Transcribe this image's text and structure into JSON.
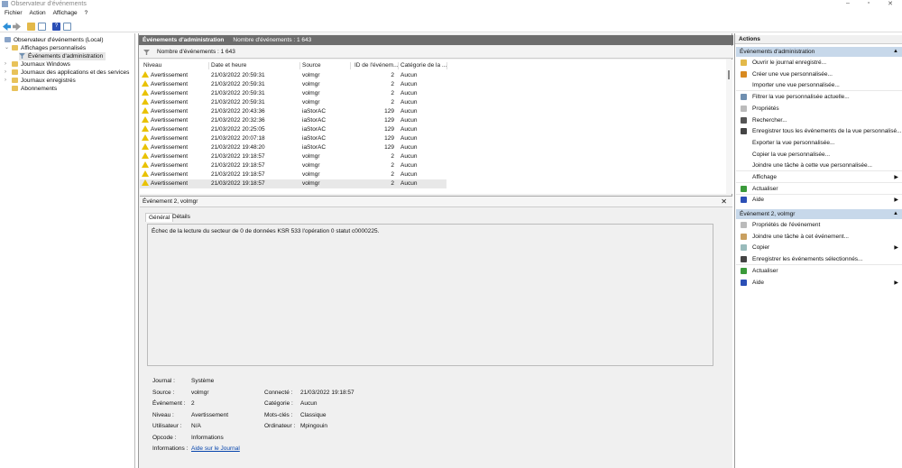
{
  "window": {
    "title": "Observateur d'événements"
  },
  "menu": [
    "Fichier",
    "Action",
    "Affichage",
    "?"
  ],
  "toolbar": [
    "back-icon",
    "forward-icon",
    "folder-up-icon",
    "console-tree-icon",
    "help-icon",
    "action-pane-icon"
  ],
  "tree": {
    "root": "Observateur d'événements (Local)",
    "custom_views": "Affichages personnalisés",
    "admin_events": "Événements d'administration",
    "windows_logs": "Journaux Windows",
    "app_logs": "Journaux des applications et des services",
    "saved_logs": "Journaux enregistrés",
    "subscriptions": "Abonnements"
  },
  "center": {
    "title": "Événements d'administration",
    "count": "Nombre d'événements : 1 643",
    "filter_count": "Nombre d'événements : 1 643",
    "columns": [
      "Niveau",
      "Date et heure",
      "Source",
      "ID de l'événem...",
      "Catégorie de la ..."
    ],
    "rows": [
      [
        "Avertissement",
        "21/03/2022 20:59:31",
        "volmgr",
        "2",
        "Aucun"
      ],
      [
        "Avertissement",
        "21/03/2022 20:59:31",
        "volmgr",
        "2",
        "Aucun"
      ],
      [
        "Avertissement",
        "21/03/2022 20:59:31",
        "volmgr",
        "2",
        "Aucun"
      ],
      [
        "Avertissement",
        "21/03/2022 20:59:31",
        "volmgr",
        "2",
        "Aucun"
      ],
      [
        "Avertissement",
        "21/03/2022 20:43:36",
        "iaStorAC",
        "129",
        "Aucun"
      ],
      [
        "Avertissement",
        "21/03/2022 20:32:36",
        "iaStorAC",
        "129",
        "Aucun"
      ],
      [
        "Avertissement",
        "21/03/2022 20:25:05",
        "iaStorAC",
        "129",
        "Aucun"
      ],
      [
        "Avertissement",
        "21/03/2022 20:07:18",
        "iaStorAC",
        "129",
        "Aucun"
      ],
      [
        "Avertissement",
        "21/03/2022 19:48:20",
        "iaStorAC",
        "129",
        "Aucun"
      ],
      [
        "Avertissement",
        "21/03/2022 19:18:57",
        "volmgr",
        "2",
        "Aucun"
      ],
      [
        "Avertissement",
        "21/03/2022 19:18:57",
        "volmgr",
        "2",
        "Aucun"
      ],
      [
        "Avertissement",
        "21/03/2022 19:18:57",
        "volmgr",
        "2",
        "Aucun"
      ],
      [
        "Avertissement",
        "21/03/2022 19:18:57",
        "volmgr",
        "2",
        "Aucun"
      ]
    ],
    "selected_row": 12
  },
  "detail": {
    "title": "Événement 2, volmgr",
    "tabs": [
      "Général",
      "Détails"
    ],
    "message": "Échec de la lecture du secteur de 0 de données KSR 533 l'opération 0 statut c0000225.",
    "labels": {
      "journal": "Journal :",
      "source": "Source :",
      "event": "Événement :",
      "level": "Niveau :",
      "user": "Utilisateur :",
      "opcode": "Opcode :",
      "info": "Informations :",
      "logged": "Connecté :",
      "category": "Catégorie :",
      "keywords": "Mots-clés :",
      "computer": "Ordinateur :"
    },
    "values": {
      "journal": "Système",
      "source": "volmgr",
      "event": "2",
      "level": "Avertissement",
      "user": "N/A",
      "opcode": "Informations",
      "info": "Aide sur le Journal",
      "logged": "21/03/2022 19:18:57",
      "category": "Aucun",
      "keywords": "Classique",
      "computer": "Mpingouin"
    }
  },
  "actions": {
    "title": "Actions",
    "section1": "Événements d'administration",
    "items1": [
      "Ouvrir le journal enregistré...",
      "Créer une vue personnalisée...",
      "Importer une vue personnalisée...",
      "Filtrer la vue personnalisée actuelle...",
      "Propriétés",
      "Rechercher...",
      "Enregistrer tous les événements de la vue personnalisé...",
      "Exporter la vue personnalisée...",
      "Copier la vue personnalisée...",
      "Joindre une tâche à cette vue personnalisée...",
      "Affichage",
      "Actualiser",
      "Aide"
    ],
    "section2": "Événement 2, volmgr",
    "items2": [
      "Propriétés de l'événement",
      "Joindre une tâche à cet événement...",
      "Copier",
      "Enregistrer les événements sélectionnés...",
      "Actualiser",
      "Aide"
    ]
  },
  "colors": {
    "header_bar": "#6d6d6d",
    "section_header": "#c7d8ea",
    "warning": "#e9c200",
    "link": "#0645ad"
  }
}
